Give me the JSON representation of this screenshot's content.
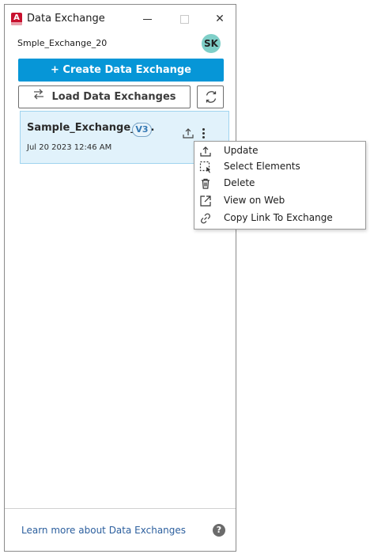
{
  "window": {
    "title": "Data Exchange",
    "controls": {
      "minimize": "",
      "maximize": "",
      "close": "✕"
    },
    "app_icon_letter": "A"
  },
  "header": {
    "exchange_name": "Smple_Exchange_20",
    "avatar_initials": "SK"
  },
  "actions": {
    "create_label": "+ Create Data Exchange",
    "load_label": "Load Data Exchanges"
  },
  "exchanges": [
    {
      "name": "Sample_Exchange_2...",
      "version": "V3",
      "date": "Jul 20 2023 12:46 AM"
    }
  ],
  "context_menu": {
    "items": [
      {
        "label": "Update",
        "icon": "upload-icon"
      },
      {
        "label": "Select Elements",
        "icon": "select-elements-icon"
      },
      {
        "label": "Delete",
        "icon": "trash-icon"
      },
      {
        "label": "View on Web",
        "icon": "external-link-icon"
      },
      {
        "label": "Copy Link To Exchange",
        "icon": "link-icon"
      }
    ]
  },
  "footer": {
    "learn_link": "Learn more about Data Exchanges",
    "help_symbol": "?"
  },
  "colors": {
    "primary_button": "#0696d7",
    "card_bg": "#e1f2fb",
    "avatar_bg": "#7fcfc8",
    "app_icon": "#c8102e",
    "link": "#2c5f9e"
  }
}
